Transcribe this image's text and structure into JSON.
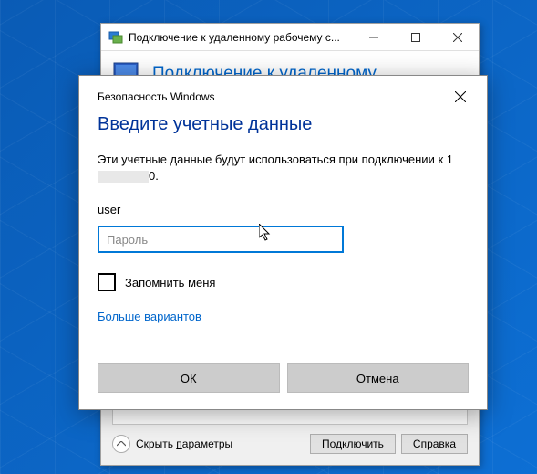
{
  "rdp": {
    "title": "Подключение к удаленному рабочему с...",
    "header_text": "Подключение к удаленному",
    "show_params": "Скрыть ",
    "show_params_u": "п",
    "show_params_rest": "араметры",
    "connect": "Подключить",
    "help": "Справка"
  },
  "security": {
    "window_title": "Безопасность Windows",
    "heading": "Введите учетные данные",
    "desc_pre": "Эти учетные данные будут использоваться при подключении к 1",
    "desc_post": "0.",
    "username": "user",
    "password_placeholder": "Пароль",
    "remember": "Запомнить меня",
    "more_options": "Больше вариантов",
    "ok": "ОК",
    "cancel": "Отмена"
  }
}
